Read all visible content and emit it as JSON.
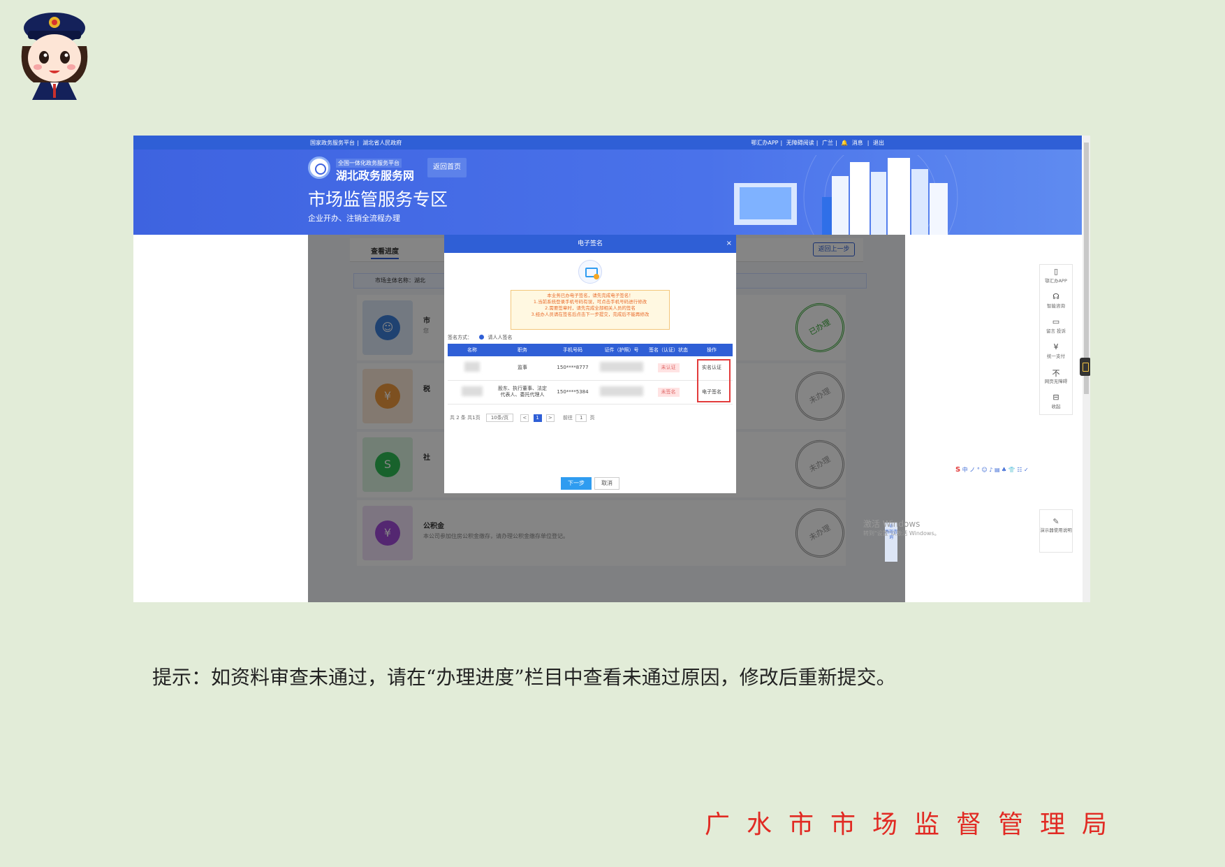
{
  "topbar": {
    "left": [
      "国家政务服务平台",
      "湖北省人民政府"
    ],
    "right": [
      "鄂汇办APP",
      "无障碍阅读",
      "广兰",
      "消息",
      "退出"
    ]
  },
  "banner": {
    "platform_sub": "全国一体化政务服务平台",
    "site_name": "湖北政务服务网",
    "home_button": "返回首页",
    "zone_title": "市场监管服务专区",
    "zone_subtitle": "企业开办、注销全流程办理"
  },
  "content": {
    "tab_title": "查看进度",
    "back_button": "返回上一步",
    "entity_bar": "市场主体名称：湖北",
    "services": [
      {
        "name": "市",
        "desc": "您",
        "stamp": "已办理",
        "icon": "shield-person-icon",
        "color": "#3d7fd9",
        "bg": "#dde8f7"
      },
      {
        "name": "税",
        "desc": "",
        "stamp": "未办理",
        "icon": "yen-icon",
        "color": "#f09a3e",
        "bg": "#fbe8d6"
      },
      {
        "name": "社",
        "desc": "",
        "stamp": "未办理",
        "icon": "social-security-icon",
        "color": "#2fbd55",
        "bg": "#dbf3e1"
      },
      {
        "name": "公积金",
        "desc": "本公司参加住房公积金缴存，请办理公积金缴存单位登记。",
        "stamp": "未办理",
        "icon": "house-yen-icon",
        "color": "#a24bd8",
        "bg": "#efe1f8"
      }
    ]
  },
  "modal": {
    "title": "电子签名",
    "close": "×",
    "notice": [
      "本业务已办电子签名，请先完成电子签名！",
      "1.当前系统登录手机号码有误，可点击手机号码进行修改",
      "2.需要签章时，请先完成全部相关人员的签名",
      "3.经办人员请在签名后点击下一步提交，完成后不能再修改"
    ],
    "sign_method_label": "签名方式：",
    "sign_method_value": "请人人签名",
    "columns": [
      "名称",
      "职务",
      "手机号码",
      "证件（护照）号",
      "签名（认证）状态",
      "操作"
    ],
    "rows": [
      {
        "role": "监事",
        "phone": "150****8777",
        "status": "未认证",
        "action": "实名认证"
      },
      {
        "role": "股东、执行董事、法定代表人、委托代理人",
        "phone": "150****5384",
        "status": "未签名",
        "action": "电子签名"
      }
    ],
    "pager": {
      "total": "共 2 条 共1页",
      "size": "10条/页",
      "prev": "<",
      "page": "1",
      "next": ">",
      "goto": "前往",
      "goto_value": "1",
      "unit": "页"
    },
    "next_button": "下一步",
    "cancel_button": "取消"
  },
  "sidebar": [
    {
      "label": "鄂汇办APP",
      "icon": "phone-icon",
      "glyph": "▯"
    },
    {
      "label": "智能咨询",
      "icon": "headset-icon",
      "glyph": "☊"
    },
    {
      "label": "留言 投诉",
      "icon": "message-icon",
      "glyph": "▭"
    },
    {
      "label": "统一支付",
      "icon": "yen-circle-icon",
      "glyph": "¥"
    },
    {
      "label": "网页无障碍",
      "icon": "accessibility-icon",
      "glyph": "不"
    },
    {
      "label": "收起",
      "icon": "collapse-icon",
      "glyph": "⊟"
    }
  ],
  "help": {
    "label": "演示器使用说明",
    "glyph": "✎"
  },
  "consult": "高效咨询",
  "ime": [
    "S",
    "中",
    "ノ",
    "°",
    "☺",
    "♪",
    "▤",
    "♣",
    "👕",
    "☷",
    "✓"
  ],
  "watermark": {
    "line1": "激活 Windows",
    "line2": "转到\"设置\"以激活 Windows。"
  },
  "caption": "提示：如资料审查未通过，请在“办理进度”栏目中查看未通过原因，修改后重新提交。",
  "organization": "广水市市场监督管理局"
}
